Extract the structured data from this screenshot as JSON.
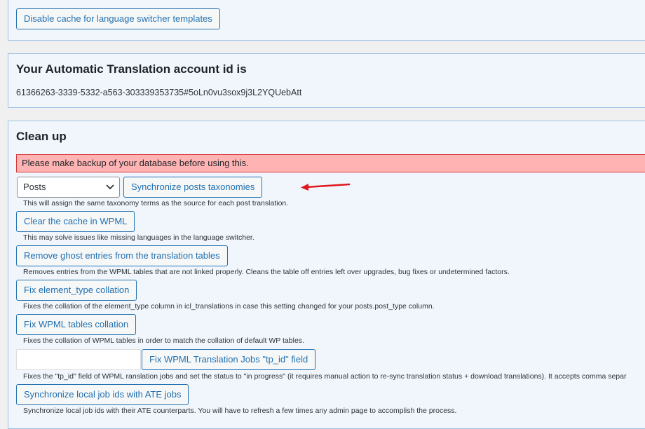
{
  "cache_panel": {
    "disable_cache_button": "Disable cache for language switcher templates"
  },
  "account_panel": {
    "title": "Your Automatic Translation account id is",
    "account_id": "61366263-3339-5332-a563-303339353735#5oLn0vu3sox9j3L2YQUebAtt"
  },
  "cleanup_panel": {
    "title": "Clean up",
    "warning": "Please make backup of your database before using this.",
    "post_type_select": {
      "selected": "Posts"
    },
    "sync_taxonomies_button": "Synchronize posts taxonomies",
    "sync_taxonomies_desc": "This will assign the same taxonomy terms as the source for each post translation.",
    "clear_cache_button": "Clear the cache in WPML",
    "clear_cache_desc": "This may solve issues like missing languages in the language switcher.",
    "remove_ghost_button": "Remove ghost entries from the translation tables",
    "remove_ghost_desc": "Removes entries from the WPML tables that are not linked properly. Cleans the table off entries left over upgrades, bug fixes or undetermined factors.",
    "fix_element_type_button": "Fix element_type collation",
    "fix_element_type_desc": "Fixes the collation of the element_type column in icl_translations in case this setting changed for your posts.post_type column.",
    "fix_tables_button": "Fix WPML tables collation",
    "fix_tables_desc": "Fixes the collation of WPML tables in order to match the collation of default WP tables.",
    "tp_id_input": {
      "value": "",
      "placeholder": ""
    },
    "fix_tp_id_button": "Fix WPML Translation Jobs \"tp_id\" field",
    "fix_tp_id_desc": "Fixes the \"tp_id\" field of WPML ranslation jobs and set the status to \"in progress\" (it requires manual action to re-sync translation status + download translations). It accepts comma separ",
    "sync_job_ids_button": "Synchronize local job ids with ATE jobs",
    "sync_job_ids_desc": "Synchronize local job ids with their ATE counterparts. You will have to refresh a few times any admin page to accomplish the process."
  },
  "annotation": {
    "arrow_color": "#e0181d",
    "icon": "arrow-left-icon"
  },
  "colors": {
    "button_accent": "#2271b1",
    "panel_bg": "#f0f6fc",
    "warning_bg": "#ffb3b3"
  }
}
